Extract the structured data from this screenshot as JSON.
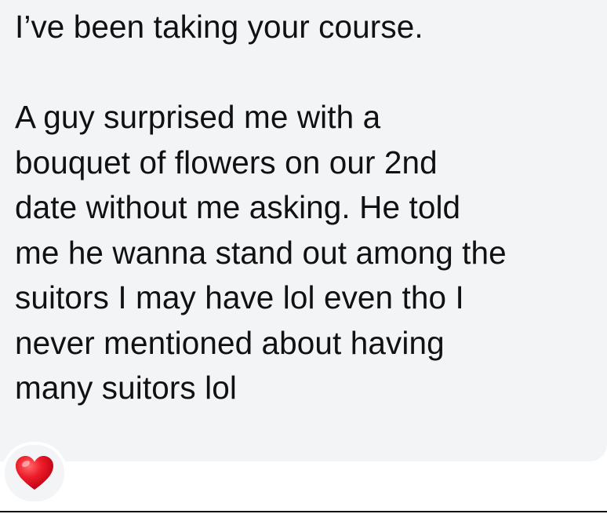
{
  "message": {
    "text": "I’ve been taking your course.\n\nA guy surprised me with a\nbouquet of flowers on our 2nd\ndate without me asking. He told\nme he wanna stand out among the\nsuitors I may have lol even tho I\nnever mentioned about having\nmany suitors lol"
  },
  "reaction": {
    "icon": "heart-icon",
    "color": "#e0101f"
  },
  "colors": {
    "bubble_background": "#f3f4f6",
    "text": "#111111"
  }
}
